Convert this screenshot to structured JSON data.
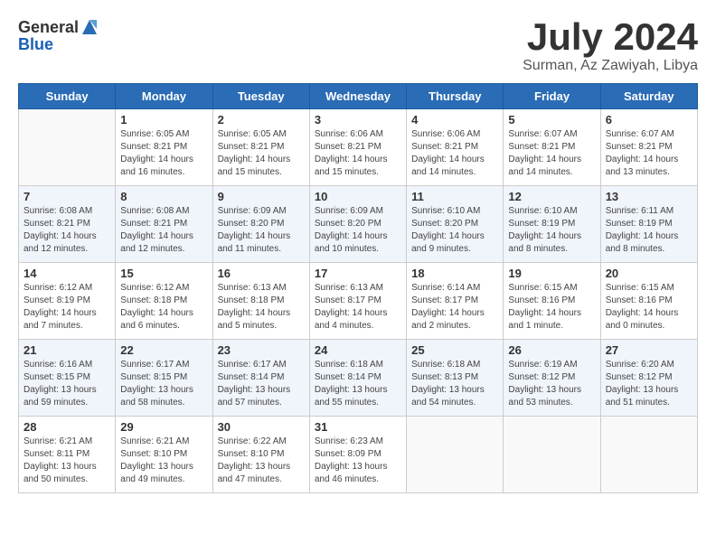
{
  "header": {
    "logo_general": "General",
    "logo_blue": "Blue",
    "month_title": "July 2024",
    "subtitle": "Surman, Az Zawiyah, Libya"
  },
  "weekdays": [
    "Sunday",
    "Monday",
    "Tuesday",
    "Wednesday",
    "Thursday",
    "Friday",
    "Saturday"
  ],
  "weeks": [
    [
      {
        "day": "",
        "info": ""
      },
      {
        "day": "1",
        "info": "Sunrise: 6:05 AM\nSunset: 8:21 PM\nDaylight: 14 hours\nand 16 minutes."
      },
      {
        "day": "2",
        "info": "Sunrise: 6:05 AM\nSunset: 8:21 PM\nDaylight: 14 hours\nand 15 minutes."
      },
      {
        "day": "3",
        "info": "Sunrise: 6:06 AM\nSunset: 8:21 PM\nDaylight: 14 hours\nand 15 minutes."
      },
      {
        "day": "4",
        "info": "Sunrise: 6:06 AM\nSunset: 8:21 PM\nDaylight: 14 hours\nand 14 minutes."
      },
      {
        "day": "5",
        "info": "Sunrise: 6:07 AM\nSunset: 8:21 PM\nDaylight: 14 hours\nand 14 minutes."
      },
      {
        "day": "6",
        "info": "Sunrise: 6:07 AM\nSunset: 8:21 PM\nDaylight: 14 hours\nand 13 minutes."
      }
    ],
    [
      {
        "day": "7",
        "info": "Sunrise: 6:08 AM\nSunset: 8:21 PM\nDaylight: 14 hours\nand 12 minutes."
      },
      {
        "day": "8",
        "info": "Sunrise: 6:08 AM\nSunset: 8:21 PM\nDaylight: 14 hours\nand 12 minutes."
      },
      {
        "day": "9",
        "info": "Sunrise: 6:09 AM\nSunset: 8:20 PM\nDaylight: 14 hours\nand 11 minutes."
      },
      {
        "day": "10",
        "info": "Sunrise: 6:09 AM\nSunset: 8:20 PM\nDaylight: 14 hours\nand 10 minutes."
      },
      {
        "day": "11",
        "info": "Sunrise: 6:10 AM\nSunset: 8:20 PM\nDaylight: 14 hours\nand 9 minutes."
      },
      {
        "day": "12",
        "info": "Sunrise: 6:10 AM\nSunset: 8:19 PM\nDaylight: 14 hours\nand 8 minutes."
      },
      {
        "day": "13",
        "info": "Sunrise: 6:11 AM\nSunset: 8:19 PM\nDaylight: 14 hours\nand 8 minutes."
      }
    ],
    [
      {
        "day": "14",
        "info": "Sunrise: 6:12 AM\nSunset: 8:19 PM\nDaylight: 14 hours\nand 7 minutes."
      },
      {
        "day": "15",
        "info": "Sunrise: 6:12 AM\nSunset: 8:18 PM\nDaylight: 14 hours\nand 6 minutes."
      },
      {
        "day": "16",
        "info": "Sunrise: 6:13 AM\nSunset: 8:18 PM\nDaylight: 14 hours\nand 5 minutes."
      },
      {
        "day": "17",
        "info": "Sunrise: 6:13 AM\nSunset: 8:17 PM\nDaylight: 14 hours\nand 4 minutes."
      },
      {
        "day": "18",
        "info": "Sunrise: 6:14 AM\nSunset: 8:17 PM\nDaylight: 14 hours\nand 2 minutes."
      },
      {
        "day": "19",
        "info": "Sunrise: 6:15 AM\nSunset: 8:16 PM\nDaylight: 14 hours\nand 1 minute."
      },
      {
        "day": "20",
        "info": "Sunrise: 6:15 AM\nSunset: 8:16 PM\nDaylight: 14 hours\nand 0 minutes."
      }
    ],
    [
      {
        "day": "21",
        "info": "Sunrise: 6:16 AM\nSunset: 8:15 PM\nDaylight: 13 hours\nand 59 minutes."
      },
      {
        "day": "22",
        "info": "Sunrise: 6:17 AM\nSunset: 8:15 PM\nDaylight: 13 hours\nand 58 minutes."
      },
      {
        "day": "23",
        "info": "Sunrise: 6:17 AM\nSunset: 8:14 PM\nDaylight: 13 hours\nand 57 minutes."
      },
      {
        "day": "24",
        "info": "Sunrise: 6:18 AM\nSunset: 8:14 PM\nDaylight: 13 hours\nand 55 minutes."
      },
      {
        "day": "25",
        "info": "Sunrise: 6:18 AM\nSunset: 8:13 PM\nDaylight: 13 hours\nand 54 minutes."
      },
      {
        "day": "26",
        "info": "Sunrise: 6:19 AM\nSunset: 8:12 PM\nDaylight: 13 hours\nand 53 minutes."
      },
      {
        "day": "27",
        "info": "Sunrise: 6:20 AM\nSunset: 8:12 PM\nDaylight: 13 hours\nand 51 minutes."
      }
    ],
    [
      {
        "day": "28",
        "info": "Sunrise: 6:21 AM\nSunset: 8:11 PM\nDaylight: 13 hours\nand 50 minutes."
      },
      {
        "day": "29",
        "info": "Sunrise: 6:21 AM\nSunset: 8:10 PM\nDaylight: 13 hours\nand 49 minutes."
      },
      {
        "day": "30",
        "info": "Sunrise: 6:22 AM\nSunset: 8:10 PM\nDaylight: 13 hours\nand 47 minutes."
      },
      {
        "day": "31",
        "info": "Sunrise: 6:23 AM\nSunset: 8:09 PM\nDaylight: 13 hours\nand 46 minutes."
      },
      {
        "day": "",
        "info": ""
      },
      {
        "day": "",
        "info": ""
      },
      {
        "day": "",
        "info": ""
      }
    ]
  ]
}
